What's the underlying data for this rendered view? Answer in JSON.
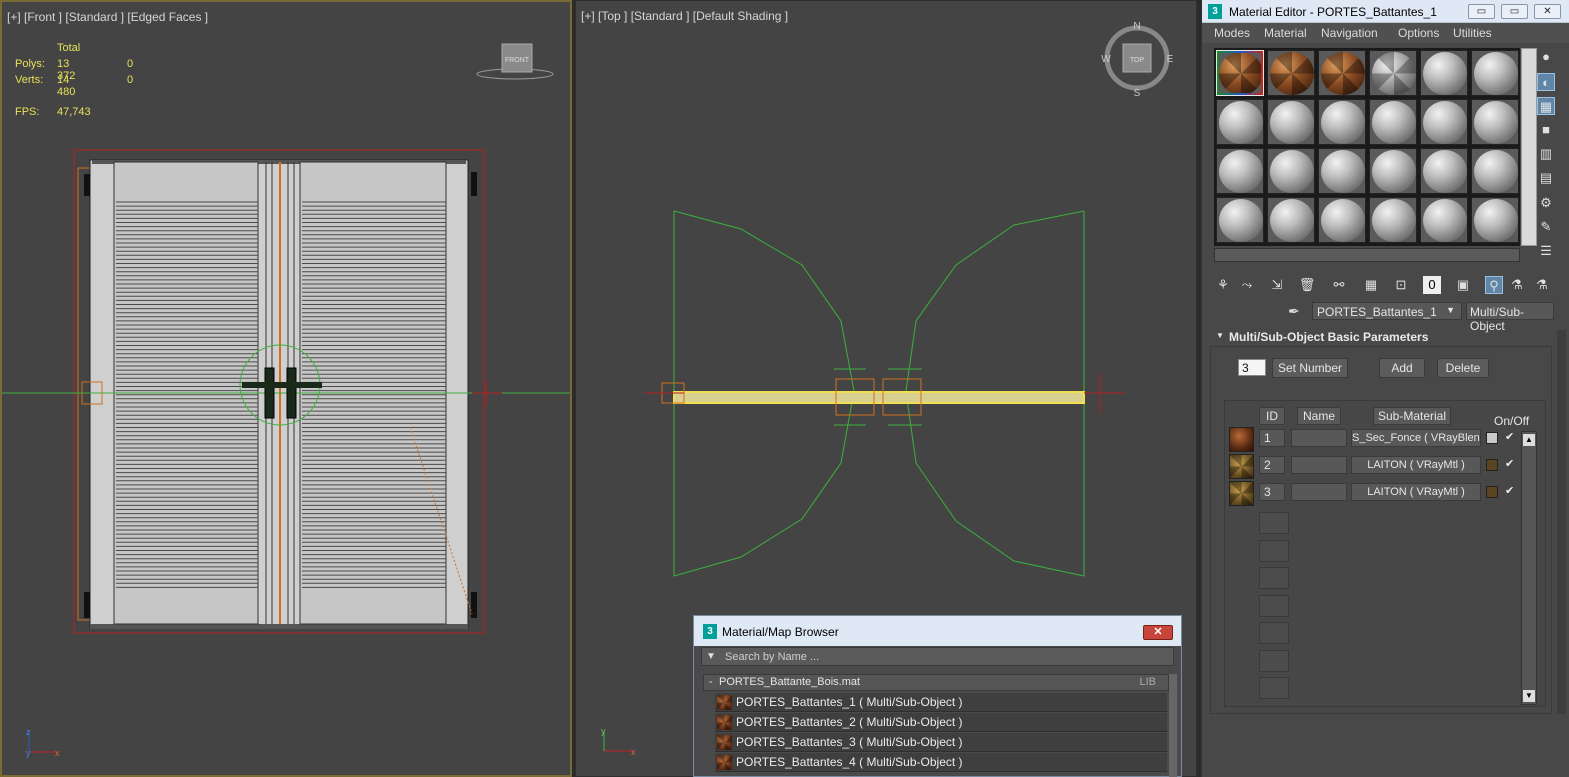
{
  "viewports": {
    "front": {
      "label": "[+] [Front ] [Standard ] [Edged Faces ]",
      "stats": {
        "total_label": "Total",
        "polys_label": "Polys:",
        "polys_total": "13 372",
        "polys_sel": "0",
        "verts_label": "Verts:",
        "verts_total": "14 480",
        "verts_sel": "0",
        "fps_label": "FPS:",
        "fps_value": "47,743"
      },
      "viewcube_label": "FRONT",
      "axis": {
        "z": "z",
        "x": "x",
        "y": "y"
      }
    },
    "top": {
      "label": "[+] [Top ] [Standard ] [Default Shading ]",
      "viewcube_label": "TOP",
      "compass": {
        "n": "N",
        "s": "S",
        "e": "E",
        "w": "W"
      },
      "axis": {
        "y": "y",
        "x": "x"
      }
    }
  },
  "material_editor": {
    "title": "Material Editor - PORTES_Battantes_1",
    "app_icon": "3",
    "window_buttons": {
      "min": "▭",
      "max": "▭",
      "close": "✕"
    },
    "menu": [
      "Modes",
      "Material",
      "Navigation",
      "Options",
      "Utilities"
    ],
    "slots": [
      "wood-checker",
      "wood-checker",
      "wood-checker",
      "grey-checker",
      "grey",
      "grey",
      "grey",
      "grey",
      "grey",
      "grey",
      "grey",
      "grey",
      "grey",
      "grey",
      "grey",
      "grey",
      "grey",
      "grey",
      "grey",
      "grey",
      "grey",
      "grey",
      "grey",
      "grey"
    ],
    "material_name": "PORTES_Battantes_1",
    "material_type": "Multi/Sub-Object",
    "rollout_title": "Multi/Sub-Object Basic Parameters",
    "set_number_value": "3",
    "buttons": {
      "set_number": "Set Number",
      "add": "Add",
      "delete": "Delete"
    },
    "columns": {
      "id": "ID",
      "name": "Name",
      "sub_material": "Sub-Material",
      "on_off": "On/Off"
    },
    "rows": [
      {
        "id": "1",
        "sub_material": "S_Sec_Fonce  ( VRayBlendM",
        "color": "#c8c8c8",
        "swatch": "wood",
        "enabled": "✔"
      },
      {
        "id": "2",
        "sub_material": "LAITON  ( VRayMtl )",
        "color": "#5a4520",
        "swatch": "brass",
        "enabled": "✔"
      },
      {
        "id": "3",
        "sub_material": "LAITON  ( VRayMtl )",
        "color": "#5a4520",
        "swatch": "brass",
        "enabled": "✔"
      }
    ]
  },
  "browser": {
    "title": "Material/Map Browser",
    "app_icon": "3",
    "close": "✕",
    "search_placeholder": "Search by Name ...",
    "library": {
      "collapse": "-",
      "name": "PORTES_Battante_Bois.mat",
      "tag": "LIB"
    },
    "items": [
      "PORTES_Battantes_1  ( Multi/Sub-Object )",
      "PORTES_Battantes_2  ( Multi/Sub-Object )",
      "PORTES_Battantes_3  ( Multi/Sub-Object )",
      "PORTES_Battantes_4  ( Multi/Sub-Object )"
    ]
  },
  "colors": {
    "viewport_bg": "#444444",
    "active_border": "#7a6a36",
    "stats_text": "#e8e05a",
    "wire_green": "#3cb03c",
    "selection_yellow": "#f0e050",
    "bbox_red": "#b02020"
  }
}
